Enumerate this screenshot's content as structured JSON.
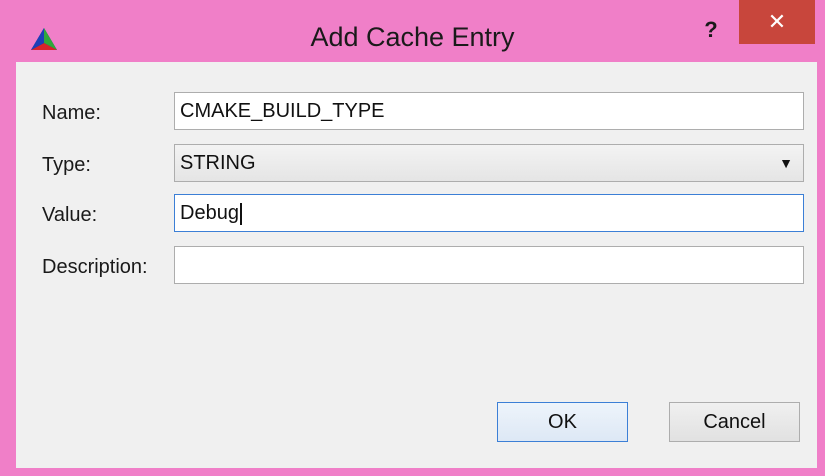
{
  "window": {
    "title": "Add Cache Entry",
    "help_label": "?",
    "close_label": "✕"
  },
  "form": {
    "name": {
      "label": "Name:",
      "value": "CMAKE_BUILD_TYPE"
    },
    "type": {
      "label": "Type:",
      "selected": "STRING"
    },
    "value": {
      "label": "Value:",
      "value": "Debug"
    },
    "description": {
      "label": "Description:",
      "value": ""
    }
  },
  "buttons": {
    "ok": "OK",
    "cancel": "Cancel"
  },
  "colors": {
    "titlebar": "#f07fc8",
    "close_button": "#c8463c",
    "focus_border": "#3c7fd6"
  },
  "icons": {
    "app": "cmake-triangle-icon",
    "dropdown": "chevron-down-icon"
  }
}
